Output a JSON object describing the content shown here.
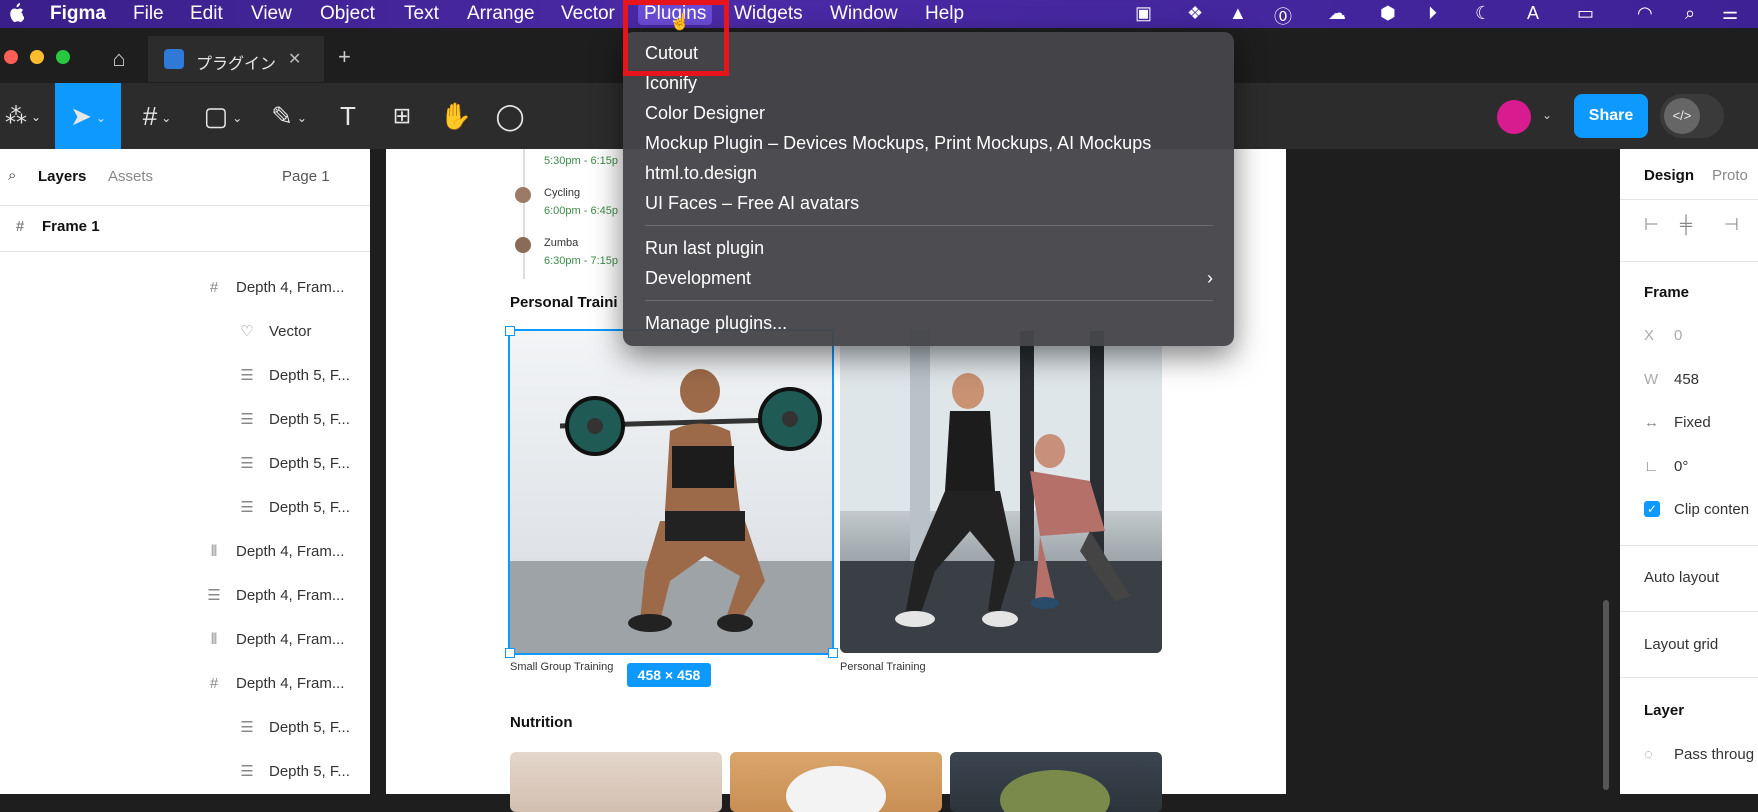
{
  "menubar": {
    "apple": "",
    "app_name": "Figma",
    "items": [
      "File",
      "Edit",
      "View",
      "Object",
      "Text",
      "Arrange",
      "Vector",
      "Plugins",
      "Widgets",
      "Window",
      "Help"
    ]
  },
  "tab": {
    "title": "プラグイン",
    "close": "✕",
    "add": "+"
  },
  "toolbar": {
    "text_tool": "T",
    "share": "Share"
  },
  "plugins_menu": {
    "items": [
      "Cutout",
      "Iconify",
      "Color Designer",
      "Mockup Plugin – Devices Mockups, Print Mockups, AI Mockups",
      "html.to.design",
      "UI Faces – Free AI avatars"
    ],
    "run_last": "Run last plugin",
    "development": "Development",
    "manage": "Manage plugins..."
  },
  "left_panel": {
    "tabs": [
      "Layers",
      "Assets"
    ],
    "page": "Page 1",
    "frame": "Frame 1",
    "layers": [
      {
        "icon": "frame-icon",
        "label": "Depth 4, Fram..."
      },
      {
        "icon": "heart-icon",
        "label": "Vector"
      },
      {
        "icon": "text-icon",
        "label": "Depth 5, F..."
      },
      {
        "icon": "text-icon",
        "label": "Depth 5, F..."
      },
      {
        "icon": "text-icon",
        "label": "Depth 5, F..."
      },
      {
        "icon": "text-icon",
        "label": "Depth 5, F..."
      },
      {
        "icon": "columns-icon",
        "label": "Depth 4, Fram..."
      },
      {
        "icon": "text-icon",
        "label": "Depth 4, Fram..."
      },
      {
        "icon": "columns-icon",
        "label": "Depth 4, Fram..."
      },
      {
        "icon": "frame-icon",
        "label": "Depth 4, Fram..."
      },
      {
        "icon": "text-icon",
        "label": "Depth 5, F..."
      },
      {
        "icon": "text-icon",
        "label": "Depth 5, F..."
      }
    ]
  },
  "canvas": {
    "schedule": [
      {
        "name": "",
        "time": "5:30pm - 6:15p"
      },
      {
        "name": "Cycling",
        "time": "6:00pm - 6:45p"
      },
      {
        "name": "Zumba",
        "time": "6:30pm - 7:15p"
      }
    ],
    "section_personal": "Personal Traini",
    "caption_left": "Small Group Training",
    "caption_right": "Personal Training",
    "size_badge": "458 × 458",
    "section_nutrition": "Nutrition"
  },
  "right_panel": {
    "tabs": [
      "Design",
      "Proto"
    ],
    "frame_label": "Frame",
    "x_label": "X",
    "x_value": "0",
    "w_label": "W",
    "w_value": "458",
    "sizing": "Fixed",
    "rotation": "0°",
    "clip": "Clip conten",
    "auto_layout": "Auto layout",
    "layout_grid": "Layout grid",
    "layer": "Layer",
    "pass_through": "Pass throug"
  },
  "colors": {
    "accent": "#0d99ff",
    "highlight": "#e8141b"
  }
}
